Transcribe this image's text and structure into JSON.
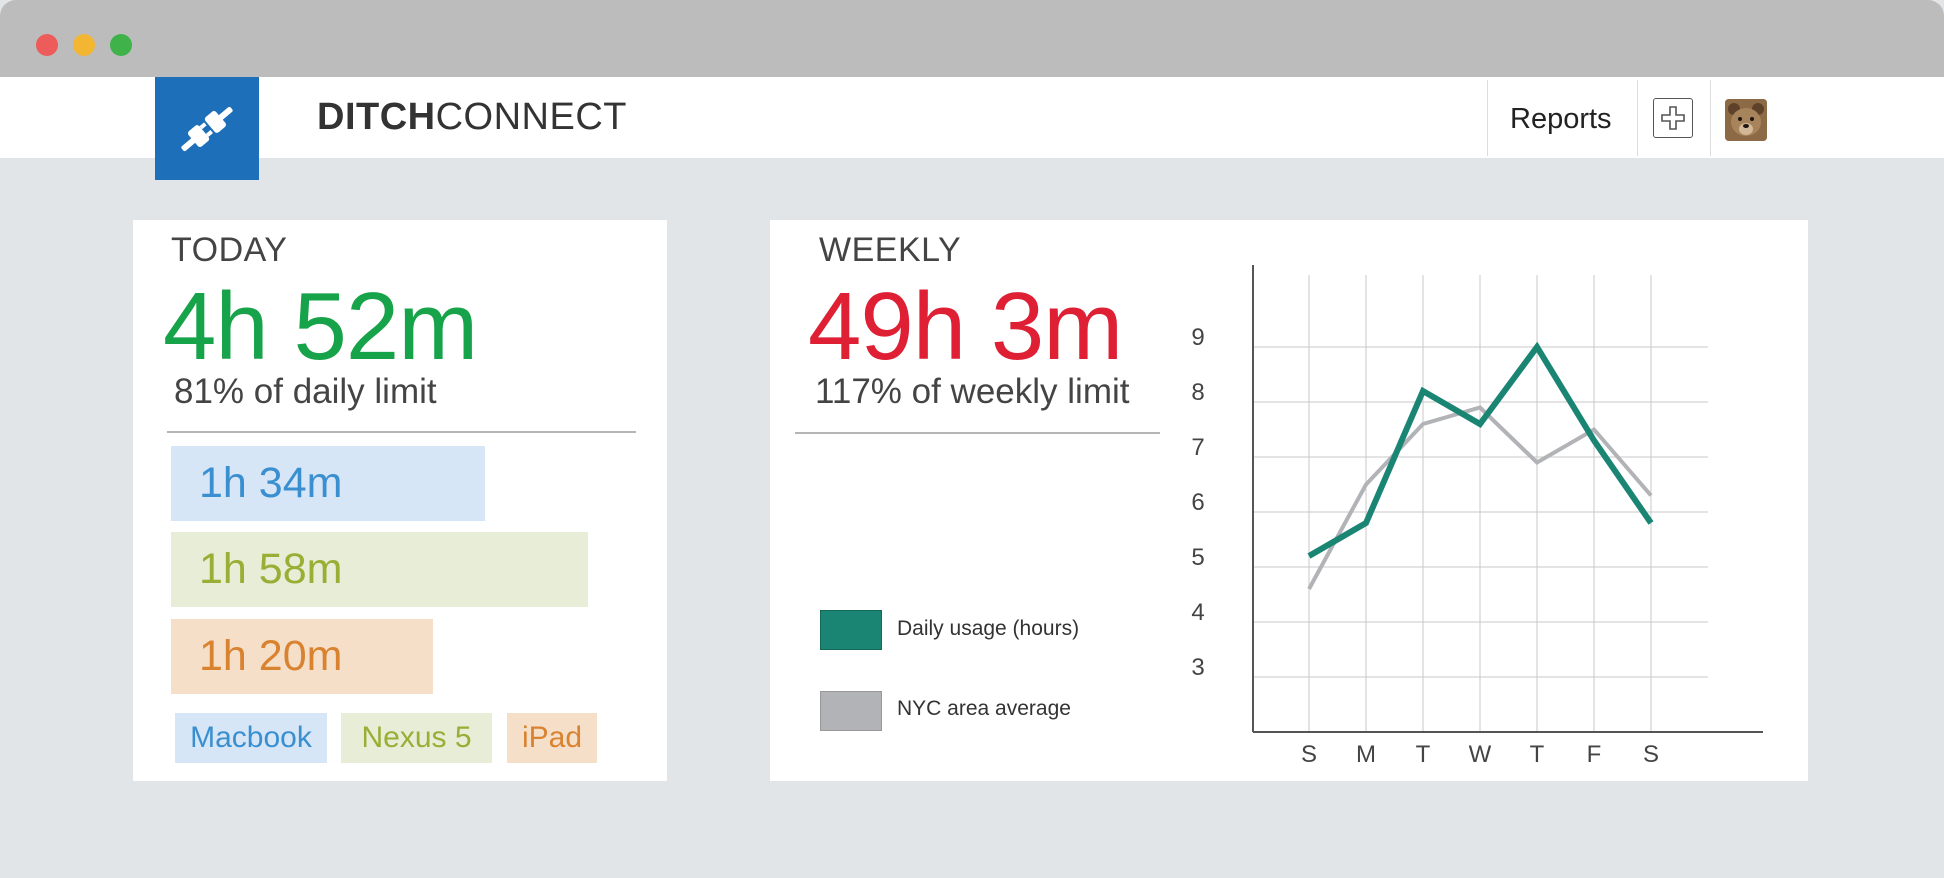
{
  "app": {
    "brand_bold": "DITCH",
    "brand_light": "CONNECT",
    "nav_reports": "Reports"
  },
  "today": {
    "label": "TODAY",
    "total": "4h 52m",
    "limit_text": "81% of daily limit",
    "devices": [
      {
        "name": "Macbook",
        "time": "1h 34m",
        "color": "#3a8fd0"
      },
      {
        "name": "Nexus 5",
        "time": "1h 58m",
        "color": "#9aad34"
      },
      {
        "name": "iPad",
        "time": "1h 20m",
        "color": "#d98330"
      }
    ]
  },
  "weekly": {
    "label": "WEEKLY",
    "total": "49h 3m",
    "limit_text": "117% of weekly limit",
    "legend": [
      {
        "label": "Daily usage (hours)",
        "color": "#1b8574"
      },
      {
        "label": "NYC area average",
        "color": "#b1b3b6"
      }
    ]
  },
  "chart_data": {
    "type": "line",
    "categories": [
      "S",
      "M",
      "T",
      "W",
      "T",
      "F",
      "S"
    ],
    "y_ticks": [
      3,
      4,
      5,
      6,
      7,
      8,
      9
    ],
    "ylim": [
      2,
      10
    ],
    "grid": true,
    "legend_position": "left",
    "series": [
      {
        "name": "Daily usage (hours)",
        "color": "#1b8574",
        "values": [
          5.2,
          5.8,
          8.2,
          7.6,
          9.0,
          7.3,
          5.8
        ]
      },
      {
        "name": "NYC area average",
        "color": "#b1b3b6",
        "values": [
          4.6,
          6.5,
          7.6,
          7.9,
          6.9,
          7.5,
          6.3
        ]
      }
    ]
  }
}
